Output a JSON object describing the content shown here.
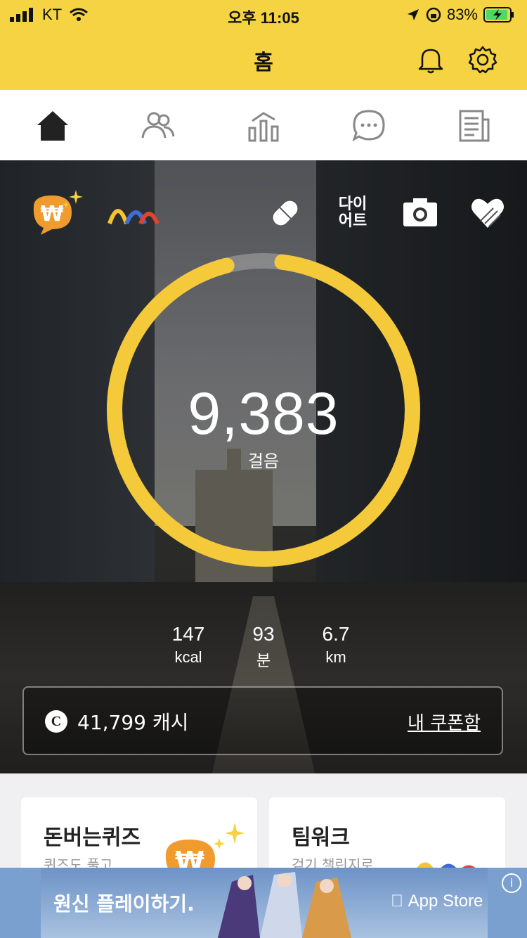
{
  "status_bar": {
    "carrier": "KT",
    "time": "오후 11:05",
    "battery": "83%"
  },
  "header": {
    "title": "홈"
  },
  "nav_tabs": [
    "home",
    "friends",
    "stats",
    "chat",
    "news"
  ],
  "quick_actions": {
    "diet_label": "다이\n어트"
  },
  "steps": {
    "count": "9,383",
    "unit": "걸음",
    "progress": 0.94
  },
  "stats": [
    {
      "value": "147",
      "unit": "kcal"
    },
    {
      "value": "93",
      "unit": "분"
    },
    {
      "value": "6.7",
      "unit": "km"
    }
  ],
  "cash": {
    "icon_letter": "C",
    "amount": "41,799 캐시",
    "coupon_link": "내 쿠폰함"
  },
  "cards": [
    {
      "title": "돈버는퀴즈",
      "subtitle": "퀴즈도 풀고"
    },
    {
      "title": "팀워크",
      "subtitle": "걷기 챌린지로"
    }
  ],
  "ad": {
    "text": "원신 플레이하기.",
    "store": " App Store",
    "info": "i"
  },
  "colors": {
    "brand": "#f6d342",
    "ring": "#f4c93a",
    "ring_track": "#9a9a9a"
  }
}
